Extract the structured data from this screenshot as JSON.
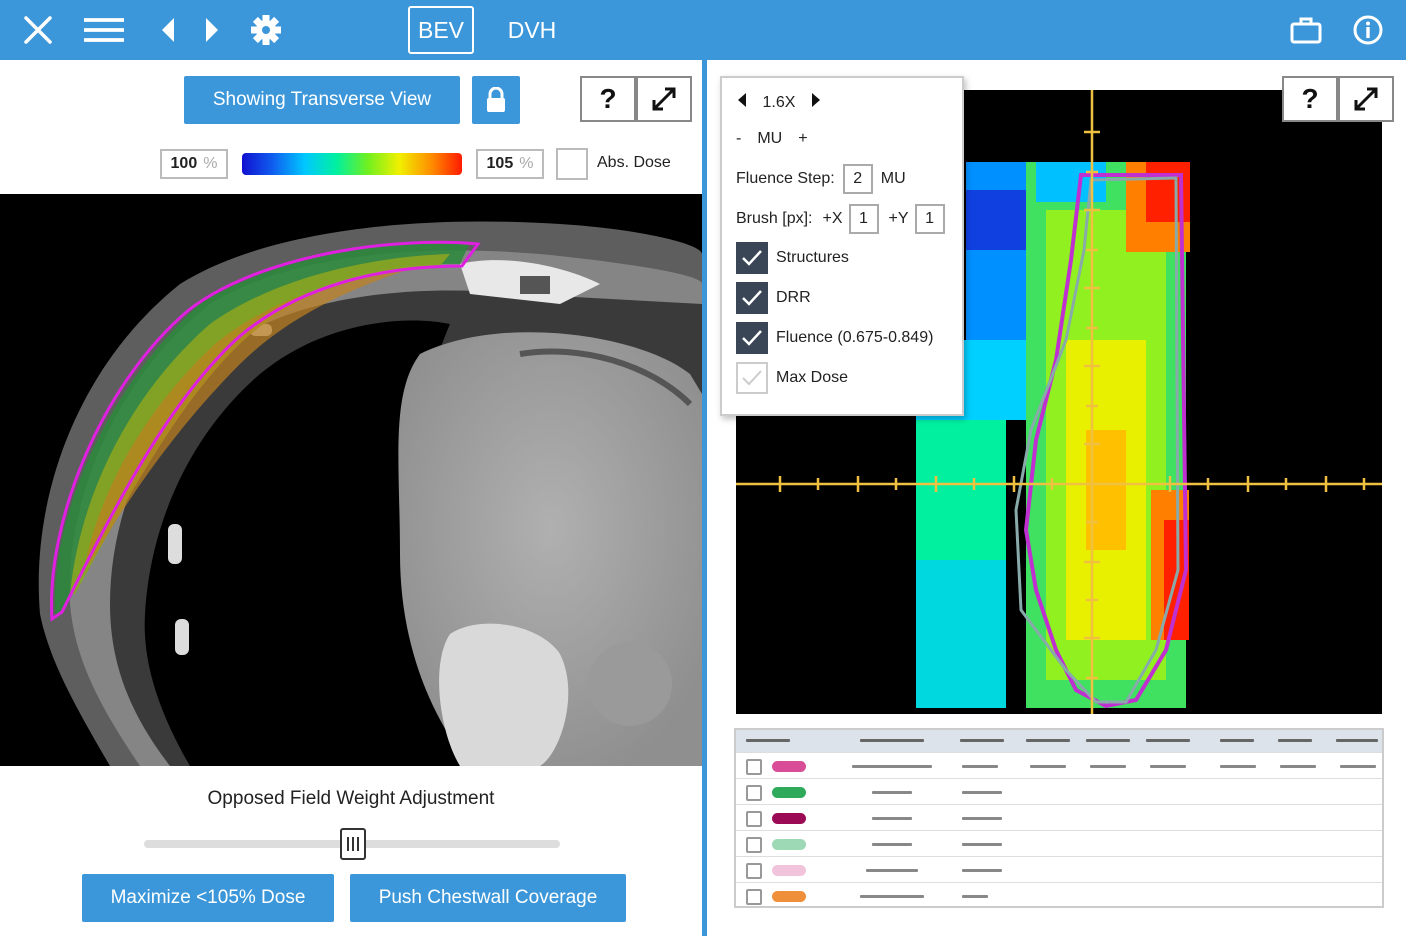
{
  "topbar": {
    "tabs": [
      {
        "label": "BEV",
        "active": true
      },
      {
        "label": "DVH",
        "active": false
      }
    ],
    "icons": [
      "close-icon",
      "menu-icon",
      "back-icon",
      "forward-icon",
      "gear-icon",
      "briefcase-icon",
      "info-icon"
    ]
  },
  "left": {
    "view_button": "Showing Transverse View",
    "lock_icon": "lock-icon",
    "help_label": "?",
    "colorbar": {
      "min_value": "100",
      "max_value": "105",
      "unit": "%",
      "abs_dose_label": "Abs. Dose"
    },
    "slider": {
      "title": "Opposed Field Weight Adjustment",
      "position": 0.5
    },
    "buttons": {
      "maximize": "Maximize <105% Dose",
      "push": "Push Chestwall Coverage"
    }
  },
  "right": {
    "help_label": "?",
    "popup": {
      "zoom": "1.6X",
      "mu_minus": "-",
      "mu_label": "MU",
      "mu_plus": "+",
      "fluence_step_label": "Fluence Step:",
      "fluence_step_value": "2",
      "fluence_step_unit": "MU",
      "brush_label": "Brush [px]:",
      "brush_x_label": "+X",
      "brush_x_value": "1",
      "brush_y_label": "+Y",
      "brush_y_value": "1",
      "options": [
        {
          "label": "Structures",
          "checked": true
        },
        {
          "label": "DRR",
          "checked": true
        },
        {
          "label": "Fluence (0.675-0.849)",
          "checked": true
        },
        {
          "label": "Max Dose",
          "checked": false
        }
      ]
    },
    "table_rows": [
      {
        "color": "#d94c98"
      },
      {
        "color": "#2eaa5a"
      },
      {
        "color": "#9b0b55"
      },
      {
        "color": "#9ed9b6"
      },
      {
        "color": "#f2c4dc"
      },
      {
        "color": "#f08f3a"
      }
    ]
  }
}
